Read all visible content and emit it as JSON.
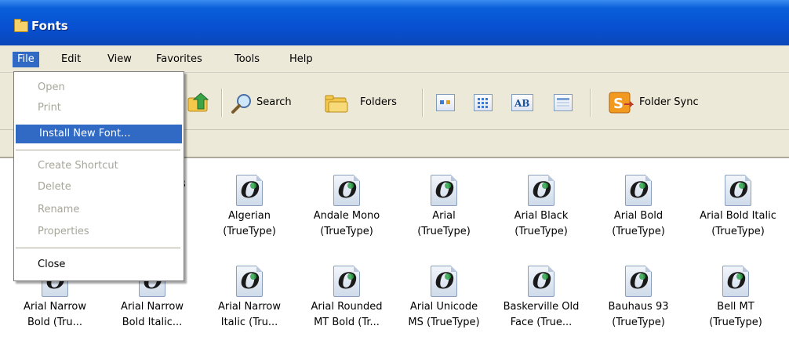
{
  "window": {
    "title": "Fonts"
  },
  "menubar": {
    "items": [
      "File",
      "Edit",
      "View",
      "Favorites",
      "Tools",
      "Help"
    ],
    "active": "File"
  },
  "toolbar": {
    "search_label": "Search",
    "folders_label": "Folders",
    "foldersync_label": "Folder Sync"
  },
  "file_menu": {
    "items": [
      {
        "label": "Open",
        "enabled": false
      },
      {
        "label": "Print",
        "enabled": false
      },
      {
        "label": "Install New Font...",
        "enabled": true,
        "highlighted": true
      },
      {
        "label": "Create Shortcut",
        "enabled": false
      },
      {
        "label": "Delete",
        "enabled": false
      },
      {
        "label": "Rename",
        "enabled": false
      },
      {
        "label": "Properties",
        "enabled": false
      },
      {
        "label": "Close",
        "enabled": true
      }
    ]
  },
  "fonts": {
    "row1": [
      {
        "name": "",
        "type": ""
      },
      {
        "name": "",
        "type": "B"
      },
      {
        "name": "Algerian",
        "type": "(TrueType)"
      },
      {
        "name": "Andale Mono",
        "type": "(TrueType)"
      },
      {
        "name": "Arial",
        "type": "(TrueType)"
      },
      {
        "name": "Arial Black",
        "type": "(TrueType)"
      },
      {
        "name": "Arial Bold",
        "type": "(TrueType)"
      },
      {
        "name": "Arial Bold Italic",
        "type": "(TrueType)"
      }
    ],
    "row2": [
      {
        "name": "Arial Narrow",
        "type": "Bold (Tru..."
      },
      {
        "name": "Arial Narrow",
        "type": "Bold Italic..."
      },
      {
        "name": "Arial Narrow",
        "type": "Italic (Tru..."
      },
      {
        "name": "Arial Rounded",
        "type": "MT Bold (Tr..."
      },
      {
        "name": "Arial Unicode",
        "type": "MS (TrueType)"
      },
      {
        "name": "Baskerville Old",
        "type": "Face (True..."
      },
      {
        "name": "Bauhaus 93",
        "type": "(TrueType)"
      },
      {
        "name": "Bell MT",
        "type": "(TrueType)"
      }
    ]
  },
  "colors": {
    "titlebar": "#0750d2",
    "selection": "#316ac5",
    "chrome": "#ece9d8"
  },
  "icons": [
    "folder-icon",
    "up-folder-icon",
    "search-icon",
    "folders-icon",
    "view-icons-icon",
    "view-list-icon",
    "view-ab-icon",
    "view-details-icon",
    "folder-sync-icon",
    "font-file-icon"
  ]
}
